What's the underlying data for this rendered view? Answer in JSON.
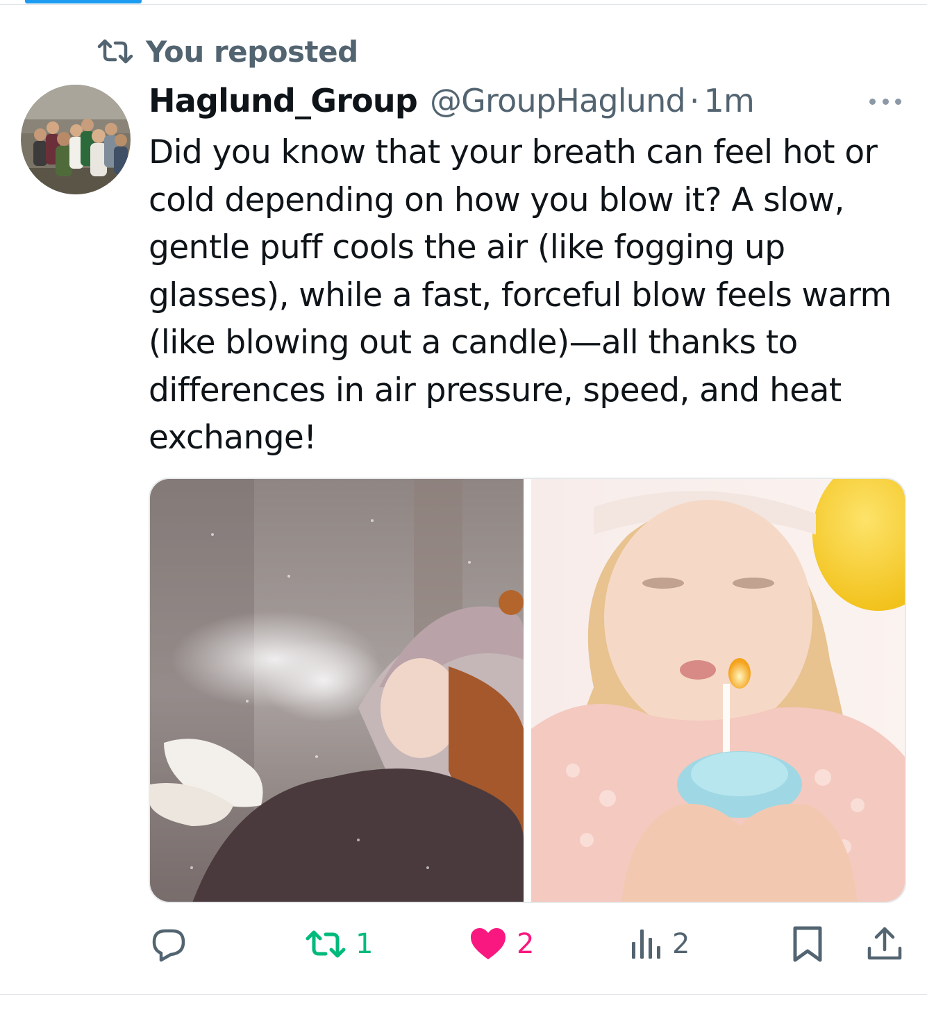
{
  "repost_banner": {
    "label": "You reposted",
    "icon": "repost-icon"
  },
  "author": {
    "display_name": "Haglund_Group",
    "handle": "@GroupHaglund",
    "separator": "·",
    "time": "1m",
    "avatar_icon": "group-photo-avatar"
  },
  "tweet": {
    "text": "Did you know that your breath can feel hot or cold depending on how you blow it? A slow, gentle puff cools the air (like fogging up glasses), while a fast, forceful blow feels warm (like blowing out a candle)—all thanks to differences in air pressure, speed, and heat exchange!"
  },
  "media": [
    {
      "icon": "photo-child-breath-in-cold"
    },
    {
      "icon": "photo-child-blowing-candle"
    }
  ],
  "actions": {
    "reply": {
      "icon": "reply-icon",
      "count": ""
    },
    "repost": {
      "icon": "repost-icon",
      "count": "1",
      "color": "#00ba7c"
    },
    "like": {
      "icon": "heart-icon",
      "count": "2",
      "color": "#f91880"
    },
    "views": {
      "icon": "views-icon",
      "count": "2"
    },
    "bookmark": {
      "icon": "bookmark-icon"
    },
    "share": {
      "icon": "share-icon"
    }
  },
  "colors": {
    "secondary_text": "#536471",
    "primary_text": "#0f1419",
    "accent": "#1d9bf0"
  }
}
